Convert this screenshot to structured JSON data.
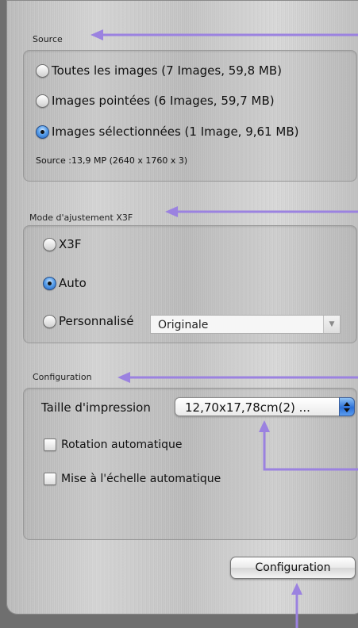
{
  "source": {
    "title": "Source",
    "options": [
      {
        "label": "Toutes les images  (7 Images, 59,8 MB)",
        "selected": false
      },
      {
        "label": "Images pointées  (6 Images, 59,7 MB)",
        "selected": false
      },
      {
        "label": "Images sélectionnées  (1 Image, 9,61 MB)",
        "selected": true
      }
    ],
    "info": "Source :13,9 MP (2640 x 1760 x 3)"
  },
  "adjust_mode": {
    "title": "Mode d'ajustement X3F",
    "options": [
      {
        "label": "X3F",
        "selected": false
      },
      {
        "label": "Auto",
        "selected": true
      },
      {
        "label": "Personnalisé",
        "selected": false
      }
    ],
    "custom_select_value": "Originale"
  },
  "configuration": {
    "title": "Configuration",
    "print_size_label": "Taille d'impression",
    "print_size_value": "12,70x17,78cm(2) ...",
    "checkboxes": [
      {
        "label": "Rotation automatique",
        "checked": false
      },
      {
        "label": "Mise à l'échelle automatique",
        "checked": false
      }
    ],
    "button_label": "Configuration"
  },
  "annotation_color": "#9b82e0"
}
